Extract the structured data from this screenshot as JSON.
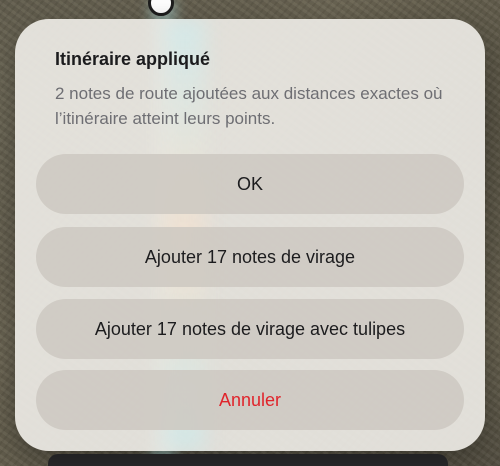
{
  "alert": {
    "title": "Itinéraire appliqué",
    "message": "2 notes de route ajoutées aux distances exactes où l’itinéraire atteint leurs points.",
    "buttons": {
      "ok": "OK",
      "add_turn_notes": "Ajouter 17 notes de virage",
      "add_turn_notes_tulips": "Ajouter 17 notes de virage avec tulipes",
      "cancel": "Annuler"
    }
  },
  "colors": {
    "cancel_text": "#e0242b",
    "button_bg": "#cdc8c1",
    "dialog_bg": "#ece9e4"
  }
}
